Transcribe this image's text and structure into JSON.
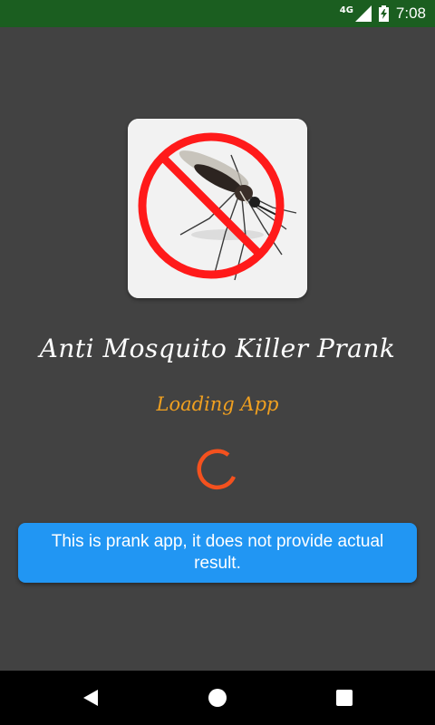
{
  "status_bar": {
    "network": "4G",
    "time": "7:08",
    "icons": [
      "signal-icon",
      "battery-charging-icon"
    ]
  },
  "app": {
    "title": "Anti Mosquito Killer Prank",
    "loading_text": "Loading App",
    "icon": "no-mosquito-icon"
  },
  "toast": {
    "message": "This is prank app, it does not provide actual result."
  },
  "nav_bar": {
    "icons": [
      "back-icon",
      "home-icon",
      "recents-icon"
    ]
  },
  "colors": {
    "status_bar": "#1b5e20",
    "background": "#424242",
    "loading_text": "#f0a020",
    "spinner": "#f4511e",
    "toast": "#2196f3",
    "nav_bar": "#000000"
  }
}
